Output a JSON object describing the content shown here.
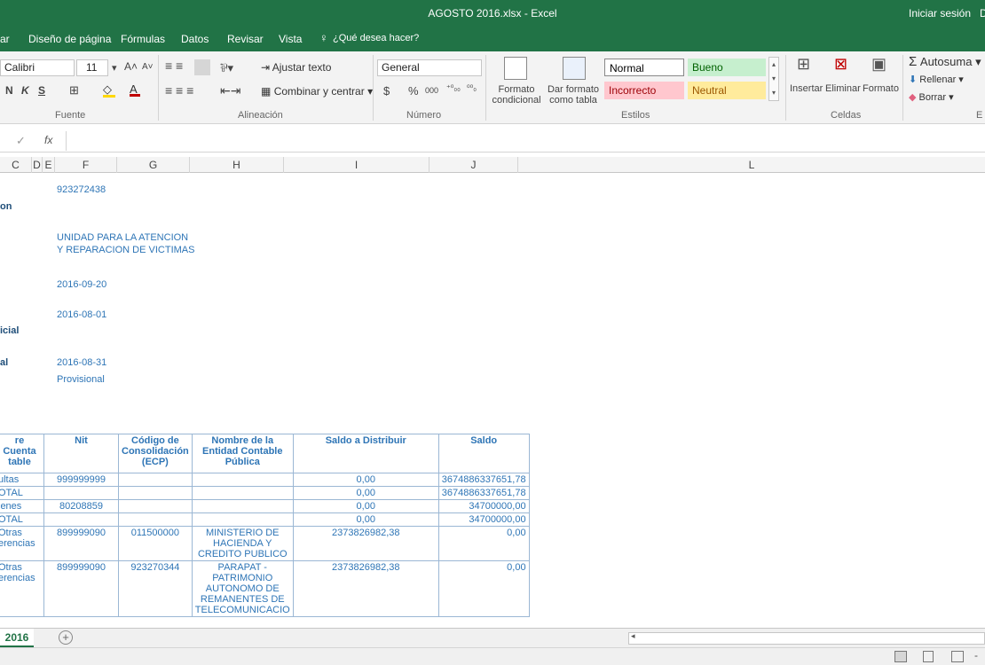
{
  "window": {
    "title": "AGOSTO 2016.xlsx - Excel",
    "signin": "Iniciar sesión",
    "partial_right": "D"
  },
  "menu": {
    "partial_left": "ar",
    "items": [
      "Diseño de página",
      "Fórmulas",
      "Datos",
      "Revisar",
      "Vista"
    ],
    "tell": "¿Qué desea hacer?"
  },
  "ribbon": {
    "font": {
      "name": "Calibri",
      "size": "11",
      "bold": "N",
      "italic": "K",
      "underline": "S",
      "label": "Fuente"
    },
    "align": {
      "wrap": "Ajustar texto",
      "merge": "Combinar y centrar",
      "label": "Alineación"
    },
    "number": {
      "format": "General",
      "currency": "$",
      "percent": "%",
      "thousands": "000",
      "label": "Número"
    },
    "styles": {
      "cond1": "Formato",
      "cond2": "condicional",
      "table1": "Dar formato",
      "table2": "como tabla",
      "normal": "Normal",
      "good": "Bueno",
      "bad": "Incorrecto",
      "neutral": "Neutral",
      "label": "Estilos",
      "colors": {
        "good_bg": "#c6efce",
        "good_fg": "#006100",
        "bad_bg": "#ffc7ce",
        "bad_fg": "#9c0006",
        "neutral_bg": "#ffeb9c",
        "neutral_fg": "#9c5700"
      }
    },
    "cells": {
      "insert": "Insertar",
      "delete": "Eliminar",
      "format": "Formato",
      "label": "Celdas"
    },
    "editing": {
      "autosum": "Autosuma",
      "fill": "Rellenar",
      "clear": "Borrar",
      "label": "E"
    }
  },
  "formula_bar": {
    "fx": "fx",
    "value": ""
  },
  "columns": [
    "C",
    "D",
    "E",
    "F",
    "G",
    "H",
    "I",
    "J",
    "L"
  ],
  "sheet_info": [
    {
      "label": "",
      "value": "923272438"
    },
    {
      "label": "on",
      "value": ""
    },
    {
      "label": "",
      "value": "UNIDAD PARA LA ATENCION"
    },
    {
      "label": "",
      "value": "Y REPARACION DE VICTIMAS"
    },
    {
      "label": "",
      "value": "2016-09-20"
    },
    {
      "label": "",
      "value": "2016-08-01"
    },
    {
      "label": "icial",
      "value": ""
    },
    {
      "label": "al",
      "value": "2016-08-31"
    },
    {
      "label": "",
      "value": "Provisional"
    }
  ],
  "table": {
    "headers": [
      "re Cuenta\ntable",
      "Nit",
      "Código de\nConsolidación\n(ECP)",
      "Nombre de la\nEntidad Contable\nPública",
      "Saldo a Distribuir",
      "Saldo"
    ],
    "rows": [
      [
        "ultas",
        "999999999",
        "",
        "",
        "0,00",
        "3674886337651,78"
      ],
      [
        "OTAL",
        "",
        "",
        "",
        "0,00",
        "3674886337651,78"
      ],
      [
        "ienes",
        "80208859",
        "",
        "",
        "0,00",
        "34700000,00"
      ],
      [
        "OTAL",
        "",
        "",
        "",
        "0,00",
        "34700000,00"
      ],
      [
        "Otras\nerencias",
        "899999090",
        "011500000",
        "MINISTERIO DE\nHACIENDA Y\nCREDITO PUBLICO",
        "2373826982,38",
        "0,00"
      ],
      [
        "Otras\nerencias",
        "899999090",
        "923270344",
        "PARAPAT -\nPATRIMONIO\nAUTONOMO DE\nREMANENTES DE\nTELECOMUNICACIO",
        "2373826982,38",
        "0,00"
      ]
    ]
  },
  "sheet_tab": {
    "name": "2016",
    "add": "+"
  },
  "accent": "#217346"
}
